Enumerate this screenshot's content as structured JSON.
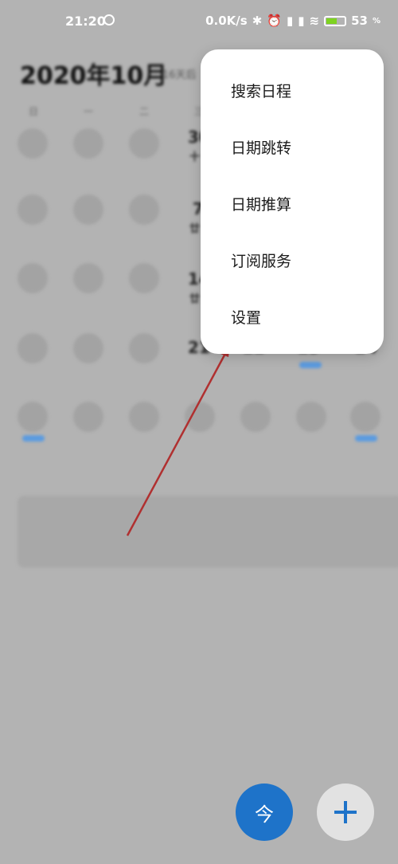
{
  "status": {
    "time": "21:20",
    "speed": "0.0K/s",
    "battery": "53",
    "battery_unit": "%"
  },
  "calendar": {
    "month_title": "2020年10月",
    "days_after": "16天后",
    "weekdays": [
      "日",
      "一",
      "二",
      "三"
    ],
    "visible_numbers": [
      "30",
      "十",
      "7",
      "廿",
      "14",
      "廿",
      "21",
      "22",
      "23",
      "24"
    ]
  },
  "menu": {
    "items": [
      "搜索日程",
      "日期跳转",
      "日期推算",
      "订阅服务",
      "设置"
    ]
  },
  "fab": {
    "today_label": "今"
  },
  "colors": {
    "accent": "#1e73c9",
    "scrim": "#b3b3b3",
    "arrow": "#b03030"
  },
  "icons": [
    "bluetooth-icon",
    "alarm-icon",
    "signal-icon",
    "wifi-icon",
    "battery-icon",
    "plus-icon"
  ]
}
